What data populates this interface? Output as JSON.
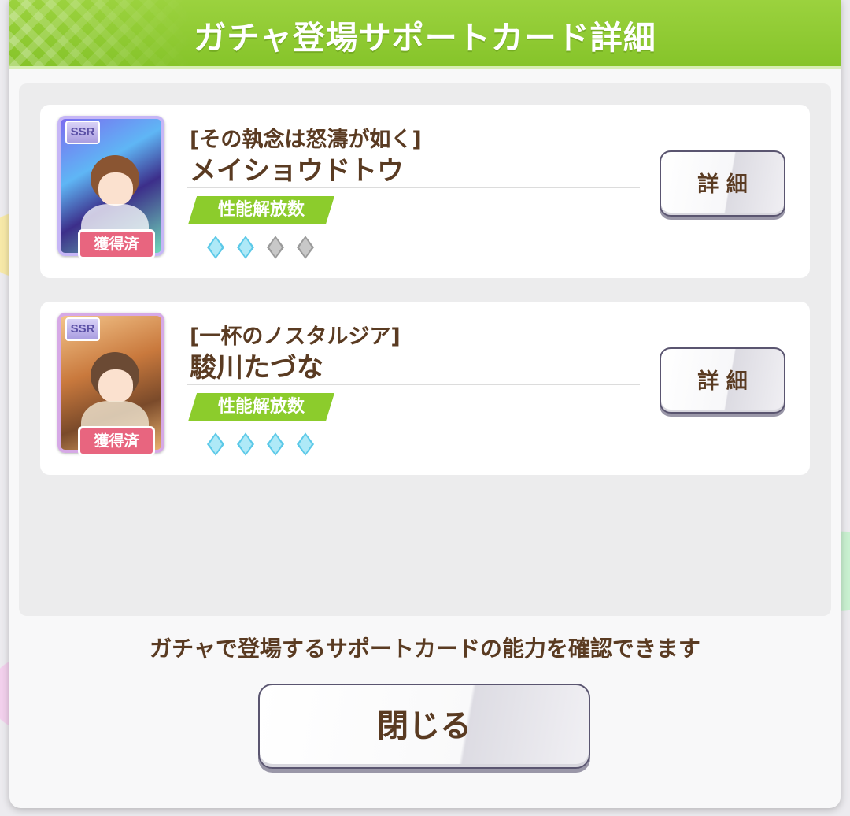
{
  "dialog": {
    "title": "ガチャ登場サポートカード詳細",
    "footer_text": "ガチャで登場するサポートカードの能力を確認できます",
    "close_label": "閉じる",
    "accent_color": "#8ccc2c"
  },
  "cards": [
    {
      "rarity": "SSR",
      "subtitle": "[その執念は怒濤が如く]",
      "name": "メイショウドトウ",
      "acquired_label": "獲得済",
      "performance_label": "性能解放数",
      "gems_unlocked": 2,
      "gems_total": 4,
      "detail_label": "詳 細"
    },
    {
      "rarity": "SSR",
      "subtitle": "[一杯のノスタルジア]",
      "name": "駿川たづな",
      "acquired_label": "獲得済",
      "performance_label": "性能解放数",
      "gems_unlocked": 4,
      "gems_total": 4,
      "detail_label": "詳 細"
    }
  ],
  "colors": {
    "gem_active": "#5cc9e8",
    "gem_inactive": "#9a9a9a",
    "acquired_badge": "#e8657f"
  }
}
